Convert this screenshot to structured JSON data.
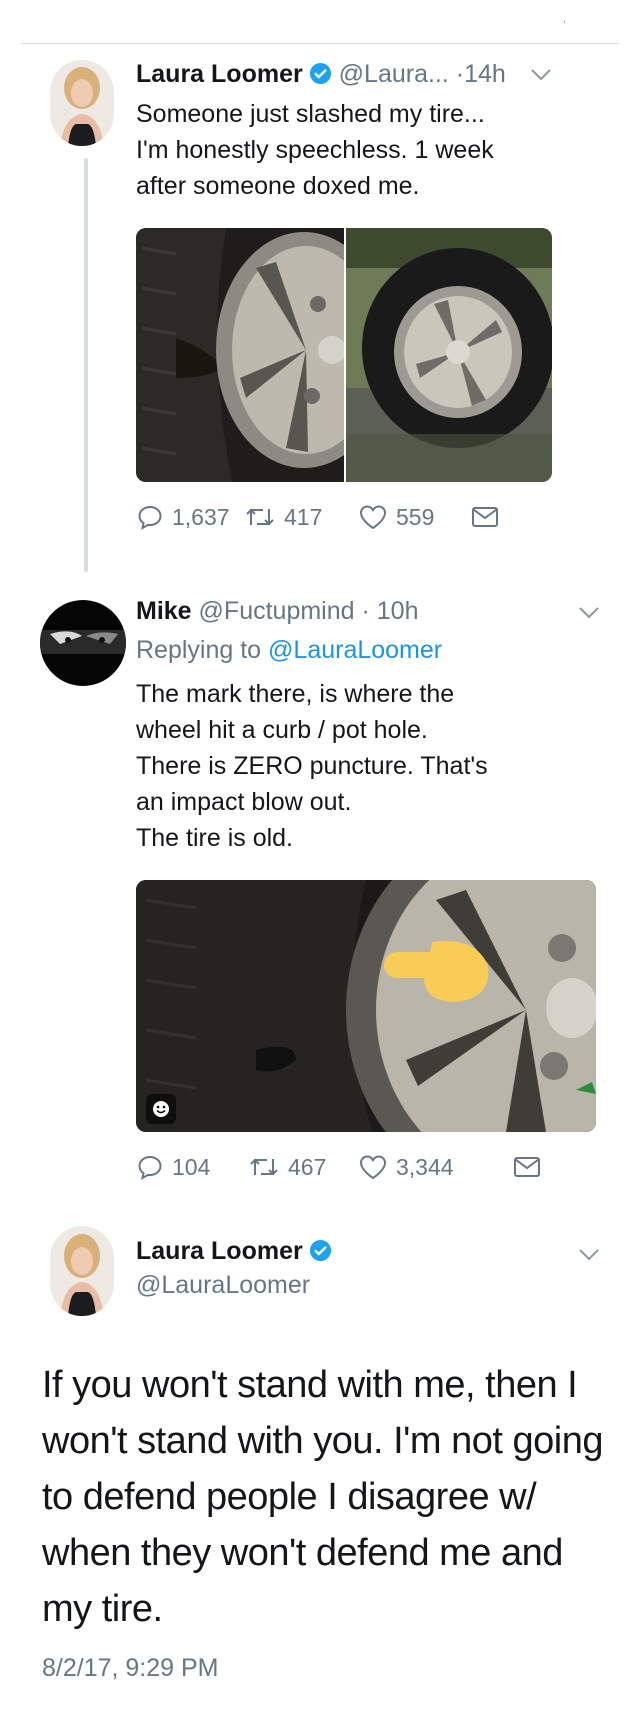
{
  "tweet1": {
    "name": "Laura Loomer",
    "handle": "@Laura...",
    "time": "·14h",
    "text": "Someone just slashed my tire...\nI'm honestly speechless. 1 week\nafter someone doxed me.",
    "replies": "1,637",
    "retweets": "417",
    "likes": "559"
  },
  "tweet2": {
    "name": "Mike",
    "handle": "@Fuctupmind",
    "time": "· 10h",
    "replying_label": "Replying to",
    "replying_handle": "@LauraLoomer",
    "text": "The mark there, is where the\nwheel hit a curb / pot hole.\nThere is ZERO puncture. That's\nan impact blow out.\nThe tire is old.",
    "replies": "104",
    "retweets": "467",
    "likes": "3,344"
  },
  "tweet3": {
    "name": "Laura Loomer",
    "handle": "@LauraLoomer",
    "text": "If you won't stand with me, then I won't stand with you. I'm not going to defend people I disagree w/ when they won't defend me and my tire.",
    "timestamp": "8/2/17, 9:29 PM"
  },
  "colors": {
    "link": "#1b95e0",
    "muted": "#657786",
    "verified": "#1da1f2"
  },
  "icons": [
    "reply-icon",
    "retweet-icon",
    "like-icon",
    "dm-icon",
    "verified-badge-icon",
    "chevron-down-icon",
    "sticker-icon"
  ]
}
